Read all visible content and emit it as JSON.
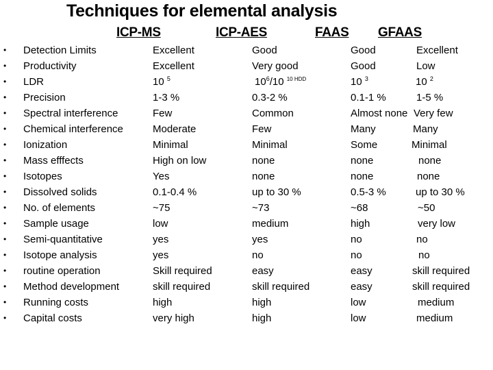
{
  "title": "Techniques for elemental analysis",
  "columns": [
    "ICP-MS",
    "ICP-AES",
    "FAAS",
    "GFAAS"
  ],
  "bullet": "•",
  "rows": [
    {
      "label": "Detection Limits",
      "icpms": "Excellent",
      "icpaes": "Good",
      "faas": "Good",
      "gfaas": "Excellent"
    },
    {
      "label": "Productivity",
      "icpms": "Excellent",
      "icpaes": "Very good",
      "faas": "Good",
      "gfaas": "Low"
    },
    {
      "label": "LDR",
      "icpms": "10^5",
      "icpaes": "10^6/10^10 HDD",
      "faas": "10^3",
      "gfaas": "10^2"
    },
    {
      "label": "Precision",
      "icpms": "1-3 %",
      "icpaes": "0.3-2 %",
      "faas": "0.1-1 %",
      "gfaas": "1-5 %"
    },
    {
      "label": "Spectral interference",
      "icpms": "Few",
      "icpaes": "Common",
      "faas": "Almost none",
      "gfaas": "Very few"
    },
    {
      "label": "Chemical interference",
      "icpms": "Moderate",
      "icpaes": "Few",
      "faas": "Many",
      "gfaas": "Many"
    },
    {
      "label": "Ionization",
      "icpms": "Minimal",
      "icpaes": "Minimal",
      "faas": "Some",
      "gfaas": "Minimal"
    },
    {
      "label": "Mass efffects",
      "icpms": "High on low",
      "icpaes": "none",
      "faas": "none",
      "gfaas": "none"
    },
    {
      "label": "Isotopes",
      "icpms": "Yes",
      "icpaes": "none",
      "faas": "none",
      "gfaas": "none"
    },
    {
      "label": "Dissolved solids",
      "icpms": "0.1-0.4 %",
      "icpaes": "up to 30 %",
      "faas": "0.5-3 %",
      "gfaas": "up to 30 %"
    },
    {
      "label": "No. of elements",
      "icpms": "~75",
      "icpaes": "~73",
      "faas": "~68",
      "gfaas": "~50"
    },
    {
      "label": "Sample usage",
      "icpms": "low",
      "icpaes": "medium",
      "faas": "high",
      "gfaas": "very low"
    },
    {
      "label": "Semi-quantitative",
      "icpms": "yes",
      "icpaes": "yes",
      "faas": "no",
      "gfaas": "no"
    },
    {
      "label": "Isotope analysis",
      "icpms": "yes",
      "icpaes": "no",
      "faas": "no",
      "gfaas": "no"
    },
    {
      "label": "routine operation",
      "icpms": "Skill required",
      "icpaes": "easy",
      "faas": "easy",
      "gfaas": "skill required"
    },
    {
      "label": "Method development",
      "icpms": "skill required",
      "icpaes": "skill required",
      "faas": "easy",
      "gfaas": "skill required"
    },
    {
      "label": "Running costs",
      "icpms": "high",
      "icpaes": "high",
      "faas": "low",
      "gfaas": "medium"
    },
    {
      "label": "Capital costs",
      "icpms": "very high",
      "icpaes": "high",
      "faas": "low",
      "gfaas": "medium"
    }
  ],
  "ldr_parts": {
    "icpms": {
      "base": "10",
      "exp": "5"
    },
    "icpaes": {
      "base1": "10",
      "exp1": "6",
      "sep": "/10",
      "exp2": "10 HDD"
    },
    "faas": {
      "base": "10",
      "exp": "3"
    },
    "gfaas": {
      "base": "10",
      "exp": "2"
    }
  }
}
